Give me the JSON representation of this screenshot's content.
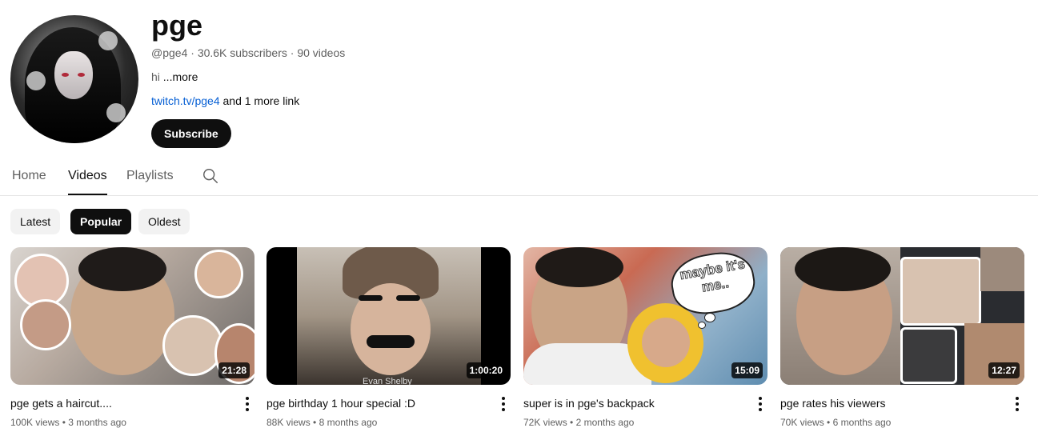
{
  "channel": {
    "name": "pge",
    "handle": "@pge4",
    "subscribers": "30.6K subscribers",
    "videos": "90 videos",
    "description": "hi",
    "more": "...more",
    "link": "twitch.tv/pge4",
    "more_links": "and 1 more link",
    "subscribe_label": "Subscribe"
  },
  "tabs": [
    {
      "label": "Home",
      "active": false
    },
    {
      "label": "Videos",
      "active": true
    },
    {
      "label": "Playlists",
      "active": false
    }
  ],
  "chips": [
    {
      "label": "Latest",
      "active": false
    },
    {
      "label": "Popular",
      "active": true
    },
    {
      "label": "Oldest",
      "active": false
    }
  ],
  "videos": [
    {
      "title": "pge gets a haircut....",
      "views": "100K views",
      "age": "3 months ago",
      "duration": "21:28"
    },
    {
      "title": "pge birthday 1 hour special :D",
      "views": "88K views",
      "age": "8 months ago",
      "duration": "1:00:20",
      "thumb_caption": "Evan Shelby"
    },
    {
      "title": "super is in pge's backpack",
      "views": "72K views",
      "age": "2 months ago",
      "duration": "15:09",
      "thumb_bubble": "maybe it's me.."
    },
    {
      "title": "pge rates his viewers",
      "views": "70K views",
      "age": "6 months ago",
      "duration": "12:27"
    }
  ],
  "colors": {
    "link": "#065fd4",
    "text": "#0f0f0f",
    "secondary": "#606060",
    "chip_bg": "#f2f2f2"
  },
  "icons": [
    "search-icon",
    "more-vert-icon"
  ]
}
